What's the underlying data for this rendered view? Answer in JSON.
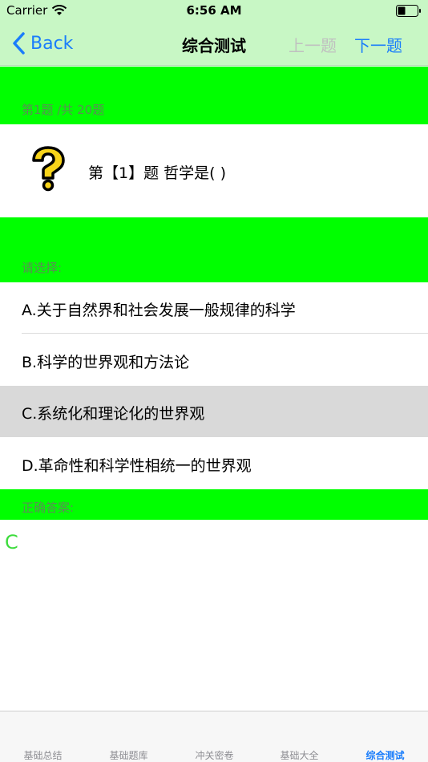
{
  "status_bar": {
    "carrier": "Carrier",
    "time": "6:56 AM"
  },
  "nav": {
    "back_label": "Back",
    "title": "综合测试",
    "prev_label": "上一题",
    "next_label": "下一题"
  },
  "progress_label": "第1题 /共 20题",
  "question": {
    "text": "第【1】题  哲学是( )"
  },
  "choose_label": "请选择:",
  "options": [
    {
      "label": "A.关于自然界和社会发展一般规律的科学"
    },
    {
      "label": "B.科学的世界观和方法论"
    },
    {
      "label": "C.系统化和理论化的世界观",
      "selected": true
    },
    {
      "label": "D.革命性和科学性相统一的世界观"
    }
  ],
  "answer_label": "正确答案:",
  "answer_value": "C",
  "tabs": [
    {
      "label": "基础总结"
    },
    {
      "label": "基础题库"
    },
    {
      "label": "冲关密卷"
    },
    {
      "label": "基础大全"
    },
    {
      "label": "综合测试",
      "active": true
    }
  ],
  "colors": {
    "accent": "#1a7dfb",
    "band": "#00ff00",
    "answer": "#3ddc3d",
    "header": "#c8f7c5"
  }
}
